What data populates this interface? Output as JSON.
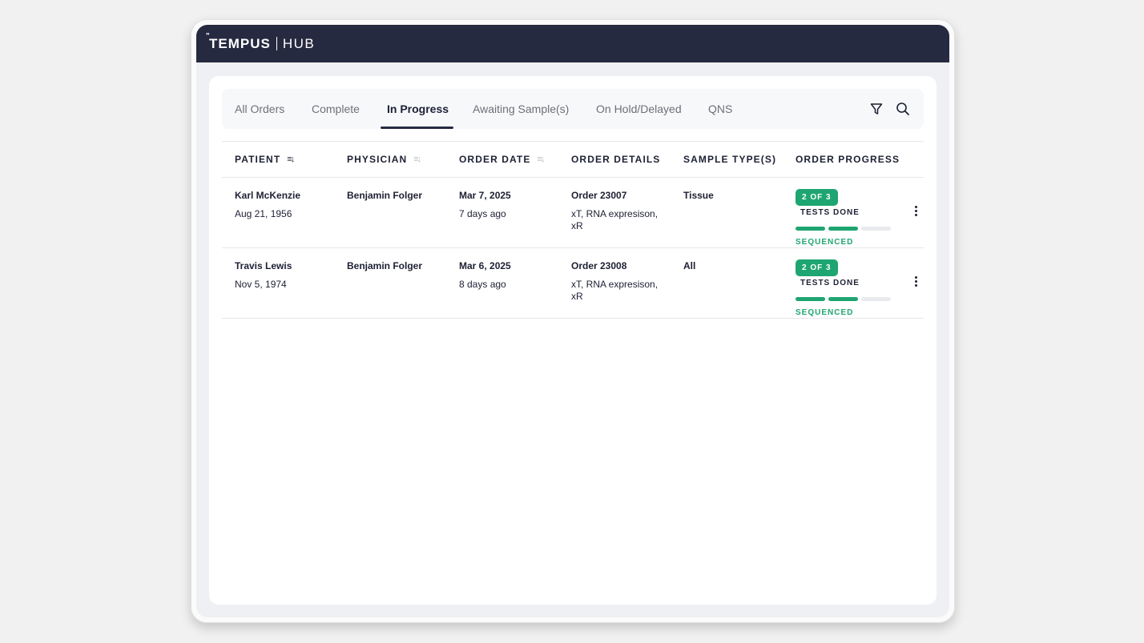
{
  "header": {
    "brand": "TEMPUS",
    "product": "HUB"
  },
  "tabs": [
    {
      "label": "All Orders",
      "active": false
    },
    {
      "label": "Complete",
      "active": false
    },
    {
      "label": "In Progress",
      "active": true
    },
    {
      "label": "Awaiting Sample(s)",
      "active": false
    },
    {
      "label": "On Hold/Delayed",
      "active": false
    },
    {
      "label": "QNS",
      "active": false
    }
  ],
  "toolbar": {
    "filter_icon": "filter-icon",
    "search_icon": "search-icon"
  },
  "columns": {
    "patient": "PATIENT",
    "physician": "PHYSICIAN",
    "order_date": "ORDER DATE",
    "order_details": "ORDER DETAILS",
    "sample_types": "SAMPLE TYPE(S)",
    "order_progress": "ORDER PROGRESS"
  },
  "rows": [
    {
      "patient_name": "Karl McKenzie",
      "dob": "Aug 21, 1956",
      "physician": "Benjamin Folger",
      "date": "Mar 7, 2025",
      "ago": "7 days ago",
      "order": "Order 23007",
      "tests": "xT, RNA expresison, xR",
      "sample": "Tissue",
      "badge": "2 OF 3",
      "tests_done": "TESTS DONE",
      "status": "SEQUENCED",
      "progress": {
        "done": 2,
        "total": 3
      }
    },
    {
      "patient_name": "Travis Lewis",
      "dob": "Nov 5, 1974",
      "physician": "Benjamin Folger",
      "date": "Mar 6, 2025",
      "ago": "8 days ago",
      "order": "Order 23008",
      "tests": "xT, RNA expresison, xR",
      "sample": "All",
      "badge": "2 OF 3",
      "tests_done": "TESTS DONE",
      "status": "SEQUENCED",
      "progress": {
        "done": 2,
        "total": 3
      }
    }
  ],
  "colors": {
    "header_bg": "#262a40",
    "accent": "#1fa571",
    "text": "#1d2033"
  }
}
